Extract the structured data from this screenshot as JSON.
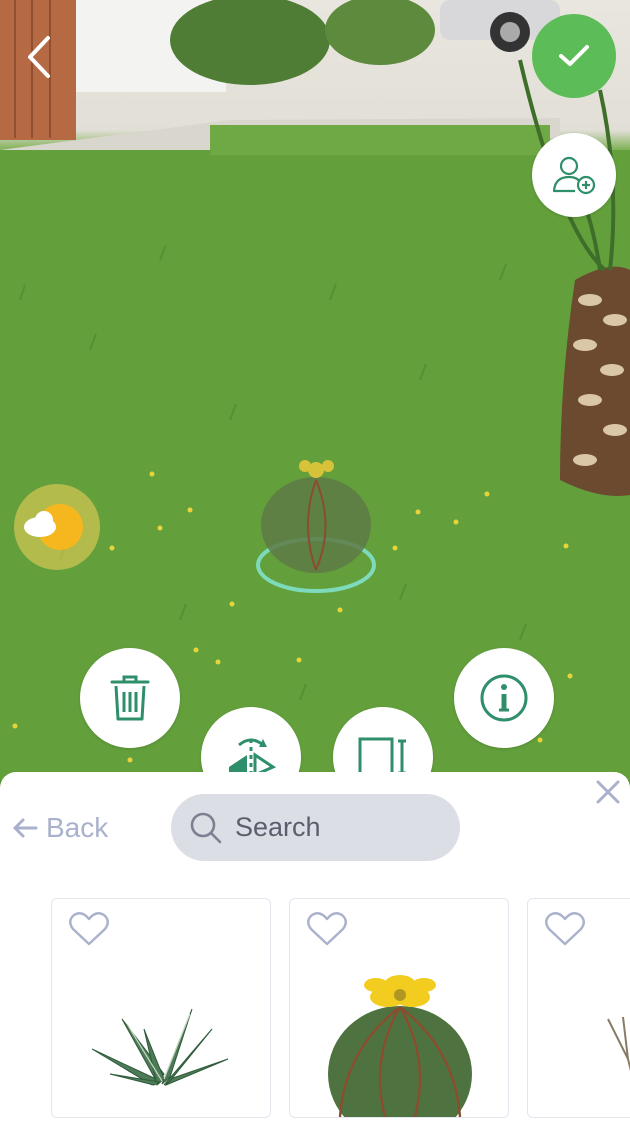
{
  "scene": {
    "description_icons": [
      "back-chevron-icon",
      "checkmark-icon",
      "user-add-icon",
      "trash-icon",
      "info-icon",
      "flip-icon",
      "resize-icon",
      "weather-icon"
    ]
  },
  "colors": {
    "accent": "#2f8f6a",
    "confirm": "#5cbd58",
    "muted": "#aab1cc",
    "search_bg": "#dcdee6"
  },
  "panel": {
    "back_label": "Back",
    "search": {
      "placeholder": "Search"
    }
  },
  "catalog": {
    "items": [
      {
        "name": "agave-plant"
      },
      {
        "name": "barrel-cactus"
      },
      {
        "name": "branch-plant"
      }
    ]
  }
}
